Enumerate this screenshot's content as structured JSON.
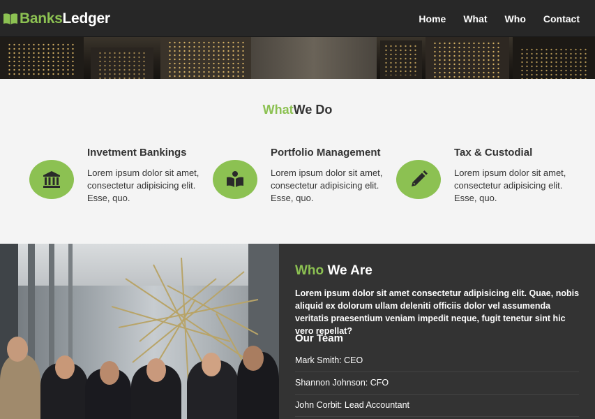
{
  "navbar": {
    "brand_first": "Banks",
    "brand_second": "Ledger",
    "brand_icon": "book-icon",
    "links": [
      "Home",
      "What",
      "Who",
      "Contact"
    ]
  },
  "what": {
    "title_accent": "What",
    "title_rest": "We Do",
    "services": [
      {
        "icon": "bank-icon",
        "title": "Invetment Bankings",
        "text": "Lorem ipsum dolor sit amet, consectetur adipisicing elit. Esse, quo."
      },
      {
        "icon": "reader-icon",
        "title": "Portfolio Management",
        "text": "Lorem ipsum dolor sit amet, consectetur adipisicing elit. Esse, quo."
      },
      {
        "icon": "pencil-icon",
        "title": "Tax & Custodial",
        "text": "Lorem ipsum dolor sit amet, consectetur adipisicing elit. Esse, quo."
      }
    ]
  },
  "who": {
    "title_accent": "Who",
    "title_rest": "We Are",
    "text": "Lorem ipsum dolor sit amet consectetur adipisicing elit. Quae, nobis aliquid ex dolorum ullam deleniti officiis dolor vel assumenda veritatis praesentium veniam impedit neque, fugit tenetur sint hic vero repellat?",
    "team_title": "Our Team",
    "team": [
      "Mark Smith: CEO",
      "Shannon Johnson: CFO",
      "John Corbit: Lead Accountant"
    ]
  },
  "colors": {
    "accent": "#8cc152",
    "dark": "#333333",
    "light": "#f4f4f4"
  }
}
